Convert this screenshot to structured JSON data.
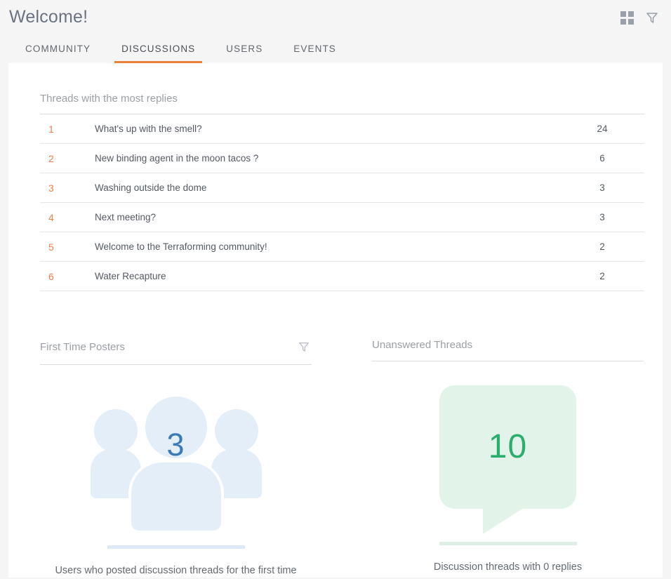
{
  "header": {
    "title": "Welcome!",
    "actions": [
      {
        "name": "grid-view-icon",
        "label": "grid-icon"
      },
      {
        "name": "filter-icon",
        "label": "funnel-icon"
      }
    ]
  },
  "tabs": [
    {
      "label": "COMMUNITY",
      "active": false
    },
    {
      "label": "DISCUSSIONS",
      "active": true
    },
    {
      "label": "USERS",
      "active": false
    },
    {
      "label": "EVENTS",
      "active": false
    }
  ],
  "threads_panel": {
    "title": "Threads with the most replies",
    "rows": [
      {
        "rank": "1",
        "title": "What's up with the smell?",
        "count": "24"
      },
      {
        "rank": "2",
        "title": "New binding agent in the moon tacos ?",
        "count": "6"
      },
      {
        "rank": "3",
        "title": "Washing outside the dome",
        "count": "3"
      },
      {
        "rank": "4",
        "title": "Next meeting?",
        "count": "3"
      },
      {
        "rank": "5",
        "title": "Welcome to the Terraforming community!",
        "count": "2"
      },
      {
        "rank": "6",
        "title": "Water Recapture",
        "count": "2"
      }
    ]
  },
  "first_time_posters": {
    "title": "First Time Posters",
    "filter_icon": "funnel-icon",
    "value": "3",
    "caption": "Users who posted discussion threads for the first time",
    "icon": "people-group-icon",
    "accent_color": "#3a7ab5",
    "fill_color": "#e4eef8"
  },
  "unanswered_threads": {
    "title": "Unanswered Threads",
    "value": "10",
    "caption": "Discussion threads with 0 replies",
    "icon": "speech-bubble-icon",
    "accent_color": "#2bad6b",
    "fill_color": "#e2f3ea"
  },
  "theme": {
    "accent": "#e8803a",
    "rank_color": "#ee8049",
    "page_bg": "#f5f5f5",
    "card_bg": "#ffffff"
  }
}
